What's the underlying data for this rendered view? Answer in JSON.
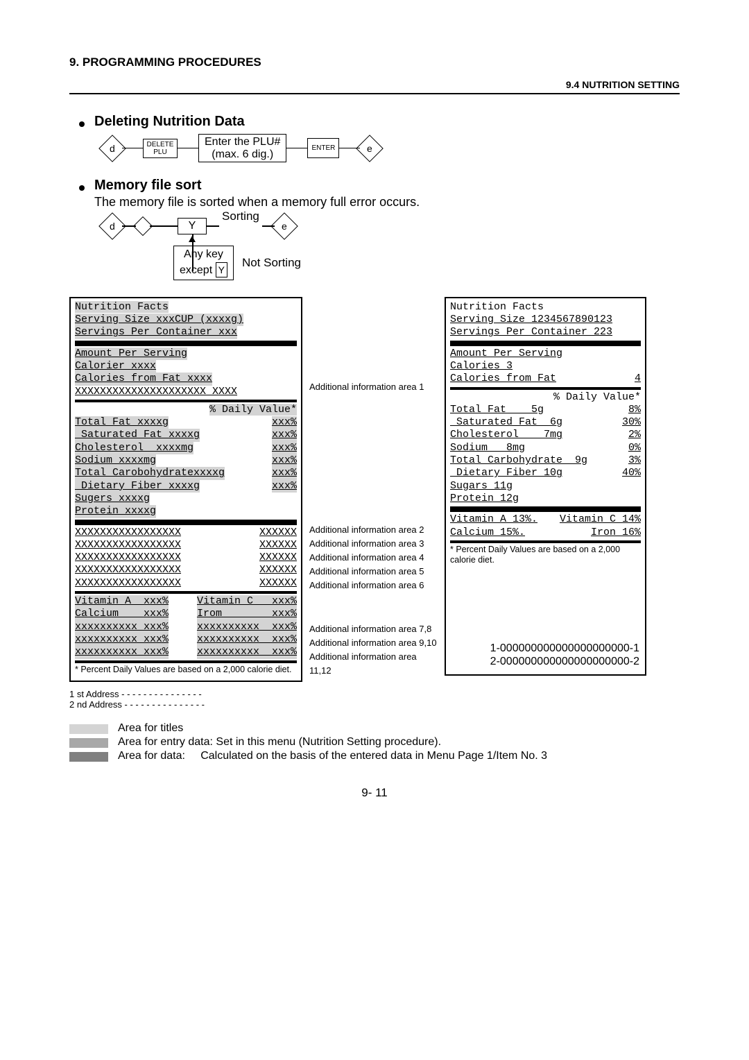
{
  "header": {
    "chapter": "9.   PROGRAMMING PROCEDURES",
    "section": "9.4 NUTRITION SETTING"
  },
  "sec_delete": {
    "title": "Deleting Nutrition Data",
    "flow": {
      "start": "d",
      "delete_top": "DELETE",
      "delete_bot": "PLU",
      "input_top": "Enter the PLU#",
      "input_bot": "(max. 6 dig.)",
      "enter": "ENTER",
      "end": "e"
    }
  },
  "sec_sort": {
    "title": "Memory file sort",
    "desc": "The memory file is sorted when a memory full error occurs.",
    "flow": {
      "start": "d",
      "y": "Y",
      "label_sorting": "Sorting",
      "end": "e",
      "anykey_top": "Any key",
      "anykey_bot": "except",
      "anykey_y": "Y",
      "label_notsorting": "Not Sorting"
    }
  },
  "left_panel": {
    "title": "Nutrition Facts",
    "serving_size": "Serving Size xxxCUP (xxxxg)",
    "servings_per": "Servings Per Container xxx",
    "amount_per_serving": "Amount Per Serving",
    "calories": "Calorier xxxx",
    "cal_from_fat": "Calories from Fat xxxx",
    "add_info_1": "XXXXXXXXXXXXXXXXXXXXX XXXX",
    "daily_value_hdr": "% Daily Value*",
    "rows": [
      {
        "l": "Total Fat xxxxg",
        "r": "xxx%"
      },
      {
        "l": " Saturated Fat xxxxg",
        "r": "xxx%"
      },
      {
        "l": "Cholesterol  xxxxmg",
        "r": "xxx%"
      },
      {
        "l": "Sodium xxxxmg",
        "r": "xxx%"
      },
      {
        "l": "Total Carobohydratexxxxg",
        "r": "xxx%"
      },
      {
        "l": " Dietary Fiber xxxxg",
        "r": "xxx%"
      }
    ],
    "sugars": "Sugers xxxxg",
    "protein": "Protein xxxxg",
    "addl": [
      {
        "l": "XXXXXXXXXXXXXXXXX",
        "r": "XXXXXX"
      },
      {
        "l": "XXXXXXXXXXXXXXXXX",
        "r": "XXXXXX"
      },
      {
        "l": "XXXXXXXXXXXXXXXXX",
        "r": "XXXXXX"
      },
      {
        "l": "XXXXXXXXXXXXXXXXX",
        "r": "XXXXXX"
      },
      {
        "l": "XXXXXXXXXXXXXXXXX",
        "r": "XXXXXX"
      }
    ],
    "vit": [
      {
        "l": "Vitamin A  xxx%",
        "r": "Vitamin C   xxx%"
      },
      {
        "l": "Calcium    xxx%",
        "r": "Irom        xxx%"
      },
      {
        "l": "xxxxxxxxxx xxx%",
        "r": "xxxxxxxxxx  xxx%"
      },
      {
        "l": "xxxxxxxxxx xxx%",
        "r": "xxxxxxxxxx  xxx%"
      },
      {
        "l": "xxxxxxxxxx xxx%",
        "r": "xxxxxxxxxx  xxx%"
      }
    ],
    "footnote": "*  Percent Daily Values are based on a 2,000 calorie diet.",
    "addr1": "1 st   Address - - - - - - - - - - - - - - -",
    "addr2": "2 nd  Address - - - - - - - - - - - - - - -"
  },
  "mid_labels": {
    "a1": "Additional information area 1",
    "a2": "Additional information area 2",
    "a3": "Additional information area 3",
    "a4": "Additional information area 4",
    "a5": "Additional information area 5",
    "a6": "Additional information area 6",
    "a78": "Additional information area 7,8",
    "a910": "Additional information area 9,10",
    "a1112": "Additional information area 11,12"
  },
  "right_panel": {
    "title": "Nutrition Facts",
    "serving_size": "Serving Size 1234567890123",
    "servings_per": "Servings Per Container 223",
    "amount_per_serving": "Amount Per Serving",
    "calories": "Calories    3",
    "cal_from_fat_l": "Calories from Fat",
    "cal_from_fat_r": "4",
    "daily_value_hdr": "% Daily Value*",
    "rows": [
      {
        "l": "Total Fat    5g",
        "r": "8%"
      },
      {
        "l": " Saturated Fat  6g",
        "r": "30%"
      },
      {
        "l": "Cholesterol    7mg",
        "r": "2%"
      },
      {
        "l": "Sodium   8mg",
        "r": "0%"
      },
      {
        "l": "Total Carbohydrate  9g",
        "r": "3%"
      },
      {
        "l": " Dietary Fiber 10g",
        "r": "40%"
      }
    ],
    "sugars": " Sugars  11g",
    "protein": "Protein  12g",
    "vit1": {
      "l": "Vitamin A 13%.",
      "r": "Vitamin C 14%"
    },
    "vit2": {
      "l": "Calcium   15%.",
      "r": "Iron      16%"
    },
    "footnote": "*  Percent Daily Values are based on a 2,000 calorie diet.",
    "code1": "1-000000000000000000000-1",
    "code2": "2-000000000000000000000-2"
  },
  "legend": {
    "titles": "Area for titles",
    "entry": "Area for entry data: Set in this menu (Nutrition Setting procedure).",
    "data_label": "Area for data:",
    "data_desc": "Calculated on the basis of the entered data in Menu Page 1/Item No. 3"
  },
  "page_no": "9- 11"
}
